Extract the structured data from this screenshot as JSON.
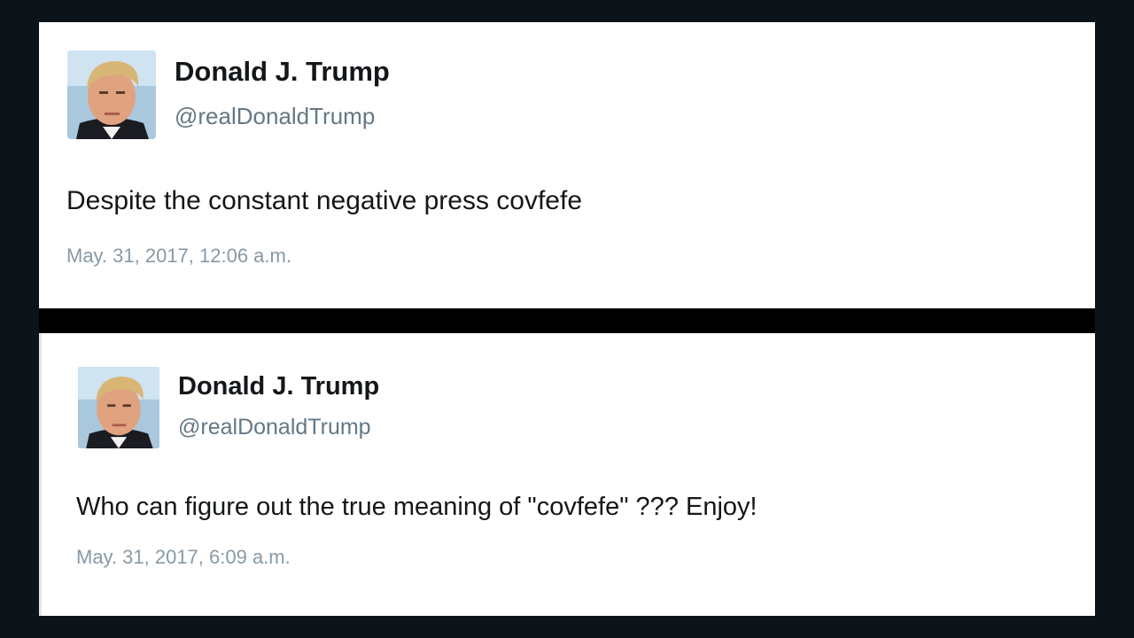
{
  "tweets": [
    {
      "name": "Donald J. Trump",
      "handle": "@realDonaldTrump",
      "text": "Despite the constant negative press covfefe",
      "timestamp": "May. 31, 2017, 12:06 a.m."
    },
    {
      "name": "Donald J. Trump",
      "handle": "@realDonaldTrump",
      "text": "Who can figure out the true meaning of \"covfefe\" ??? Enjoy!",
      "timestamp": "May. 31, 2017, 6:09 a.m."
    }
  ],
  "colors": {
    "background": "#0d1419",
    "card": "#ffffff",
    "name": "#14171a",
    "handle": "#657786",
    "timestamp": "#8899a6"
  },
  "icons": {
    "avatar": "profile-photo-avatar"
  }
}
